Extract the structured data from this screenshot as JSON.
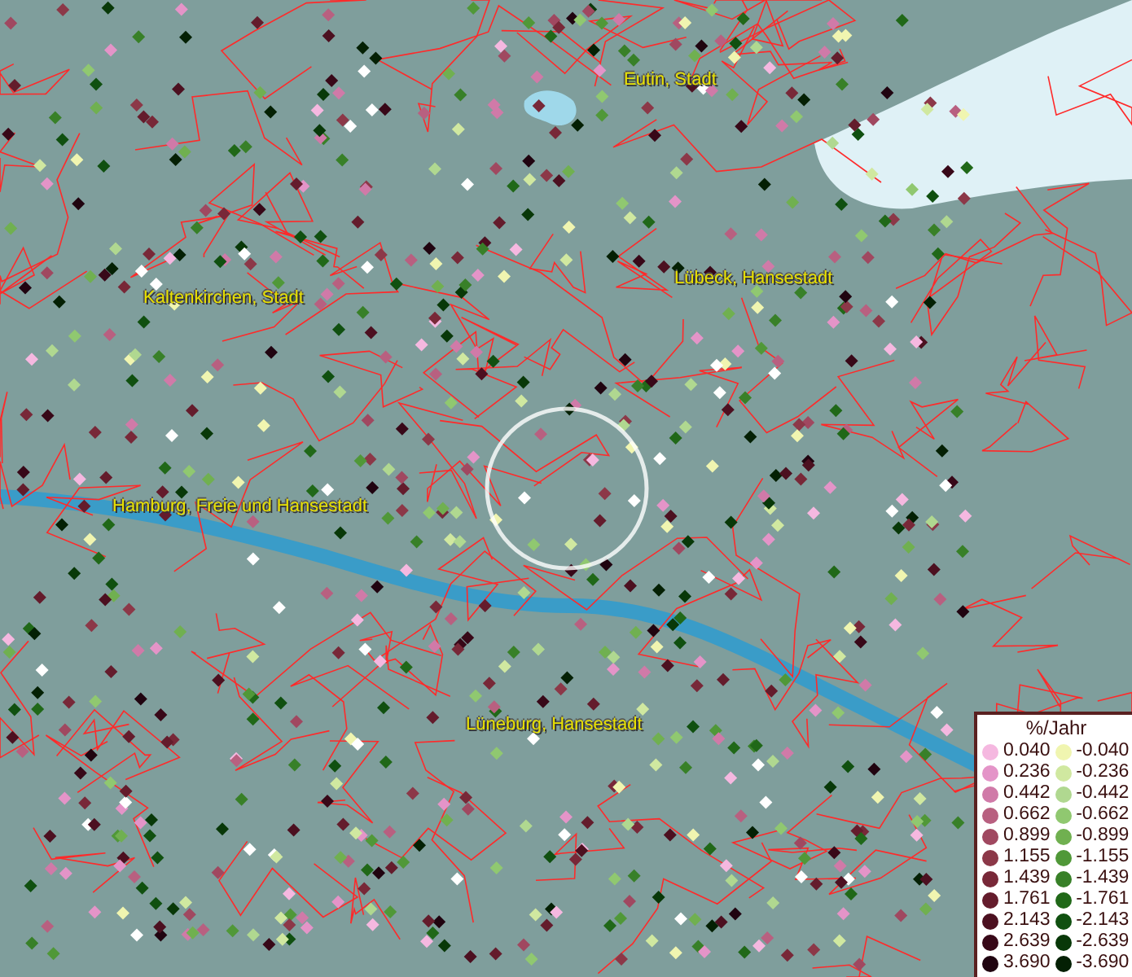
{
  "map": {
    "places": [
      {
        "name": "Eutin, Stadt"
      },
      {
        "name": "Kaltenkirchen, Stadt"
      },
      {
        "name": "Lübeck, Hansestadt"
      },
      {
        "name": "Hamburg, Freie und Hansestadt"
      },
      {
        "name": "Lüneburg, Hansestadt"
      }
    ]
  },
  "legend": {
    "title": "%/Jahr",
    "positive": [
      {
        "label": "0.040",
        "color": "#f5b8e0"
      },
      {
        "label": "0.236",
        "color": "#e494c8"
      },
      {
        "label": "0.442",
        "color": "#d07aa8"
      },
      {
        "label": "0.662",
        "color": "#b86080"
      },
      {
        "label": "0.899",
        "color": "#a04860"
      },
      {
        "label": "1.155",
        "color": "#8c3848"
      },
      {
        "label": "1.439",
        "color": "#782838"
      },
      {
        "label": "1.761",
        "color": "#641c2c"
      },
      {
        "label": "2.143",
        "color": "#4c1020"
      },
      {
        "label": "2.639",
        "color": "#380818"
      },
      {
        "label": "3.690",
        "color": "#200410"
      }
    ],
    "negative": [
      {
        "label": "-0.040",
        "color": "#f0f5b0"
      },
      {
        "label": "-0.236",
        "color": "#d0e8a0"
      },
      {
        "label": "-0.442",
        "color": "#b0d890"
      },
      {
        "label": "-0.662",
        "color": "#90c870"
      },
      {
        "label": "-0.899",
        "color": "#70b050"
      },
      {
        "label": "-1.155",
        "color": "#509838"
      },
      {
        "label": "-1.439",
        "color": "#388028"
      },
      {
        "label": "-1.761",
        "color": "#206818"
      },
      {
        "label": "-2.143",
        "color": "#105010"
      },
      {
        "label": "-2.639",
        "color": "#083808"
      },
      {
        "label": "-3.690",
        "color": "#042004"
      }
    ]
  }
}
